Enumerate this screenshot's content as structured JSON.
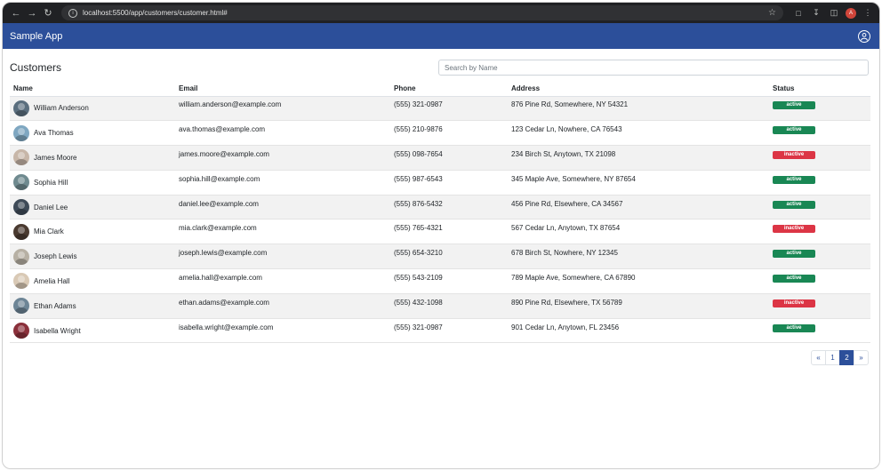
{
  "browser": {
    "url": "localhost:5500/app/customers/customer.html#",
    "profile_initial": "A"
  },
  "app": {
    "title": "Sample App"
  },
  "page": {
    "title": "Customers",
    "search_placeholder": "Search by Name"
  },
  "table": {
    "headers": {
      "name": "Name",
      "email": "Email",
      "phone": "Phone",
      "address": "Address",
      "status": "Status"
    },
    "rows": [
      {
        "name": "William Anderson",
        "email": "william.anderson@example.com",
        "phone": "(555) 321-0987",
        "address": "876 Pine Rd, Somewhere, NY 54321",
        "status": "active",
        "avatar_color": "#5a6e7e"
      },
      {
        "name": "Ava Thomas",
        "email": "ava.thomas@example.com",
        "phone": "(555) 210-9876",
        "address": "123 Cedar Ln, Nowhere, CA 76543",
        "status": "active",
        "avatar_color": "#7fa7c1"
      },
      {
        "name": "James Moore",
        "email": "james.moore@example.com",
        "phone": "(555) 098-7654",
        "address": "234 Birch St, Anytown, TX 21098",
        "status": "inactive",
        "avatar_color": "#c7b6a8"
      },
      {
        "name": "Sophia Hill",
        "email": "sophia.hill@example.com",
        "phone": "(555) 987-6543",
        "address": "345 Maple Ave, Somewhere, NY 87654",
        "status": "active",
        "avatar_color": "#6f8a8f"
      },
      {
        "name": "Daniel Lee",
        "email": "daniel.lee@example.com",
        "phone": "(555) 876-5432",
        "address": "456 Pine Rd, Elsewhere, CA 34567",
        "status": "active",
        "avatar_color": "#3e4a57"
      },
      {
        "name": "Mia Clark",
        "email": "mia.clark@example.com",
        "phone": "(555) 765-4321",
        "address": "567 Cedar Ln, Anytown, TX 87654",
        "status": "inactive",
        "avatar_color": "#4a3a30"
      },
      {
        "name": "Joseph Lewis",
        "email": "joseph.lewis@example.com",
        "phone": "(555) 654-3210",
        "address": "678 Birch St, Nowhere, NY 12345",
        "status": "active",
        "avatar_color": "#b7b0a4"
      },
      {
        "name": "Amelia Hall",
        "email": "amelia.hall@example.com",
        "phone": "(555) 543-2109",
        "address": "789 Maple Ave, Somewhere, CA 67890",
        "status": "active",
        "avatar_color": "#d9c9b5"
      },
      {
        "name": "Ethan Adams",
        "email": "ethan.adams@example.com",
        "phone": "(555) 432-1098",
        "address": "890 Pine Rd, Elsewhere, TX 56789",
        "status": "inactive",
        "avatar_color": "#6d8596"
      },
      {
        "name": "Isabella Wright",
        "email": "isabella.wright@example.com",
        "phone": "(555) 321-0987",
        "address": "901 Cedar Ln, Anytown, FL 23456",
        "status": "active",
        "avatar_color": "#8a2f3a"
      }
    ]
  },
  "pagination": {
    "prev": "«",
    "pages": [
      "1",
      "2"
    ],
    "current": "2",
    "next": "»"
  },
  "colors": {
    "header_bg": "#2c4f9a",
    "active": "#198754",
    "inactive": "#dc3545"
  }
}
